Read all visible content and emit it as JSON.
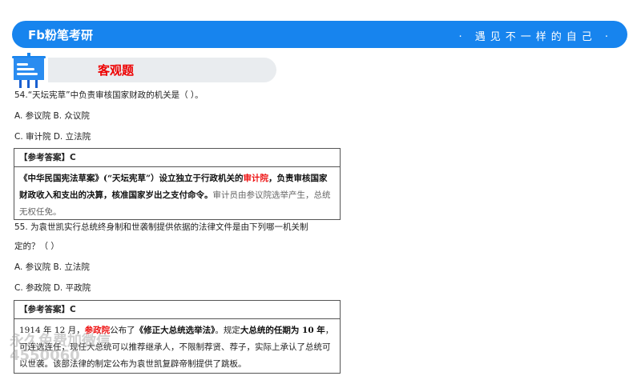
{
  "header": {
    "logo": "Fb粉笔考研",
    "slogan": "· 遇见不一样的自己 ·"
  },
  "section_title": "客观题",
  "questions": [
    {
      "stem": "54.“天坛宪草”中负责审核国家财政的机关是（ ）。",
      "options": [
        "A. 参议院 B. 众议院",
        "C. 审计院 D. 立法院"
      ],
      "answer": "【参考答案】C",
      "explanation": {
        "p1": "《中华民国宪法草案》(“天坛宪草”）设立独立于行政机关的",
        "red": "审计院",
        "p2": "，负责审核国家财政收入和支出的决算，核准国家岁出之支付命令。",
        "p3": "审计员由参议院选举产生，总统无权任免。"
      }
    },
    {
      "stem1": "55. 为袁世凯实行总统终身制和世袭制提供依据的法律文件是由下列哪一机关制",
      "stem2": "定的？（ ）",
      "options": [
        "A. 参议院 B. 立法院",
        "C. 参政院 D. 平政院"
      ],
      "answer": "【参考答案】C",
      "explanation": {
        "p1": "1914 年 12 月，",
        "red": "参政院",
        "p2": "公布了",
        "b1": "《修正大总统选举法》",
        "p3": "。规定",
        "b2": "大总统的任期为 10 年",
        "p4": "，可连选连任，现任大总统可以推荐继承人，不限制荐贤、荐子，实际上承认了总统可以世袭。该部法律的制定公布为袁世凯复辟帝制提供了跳板。"
      }
    }
  ],
  "watermark": "永久免费加微信 4550060"
}
